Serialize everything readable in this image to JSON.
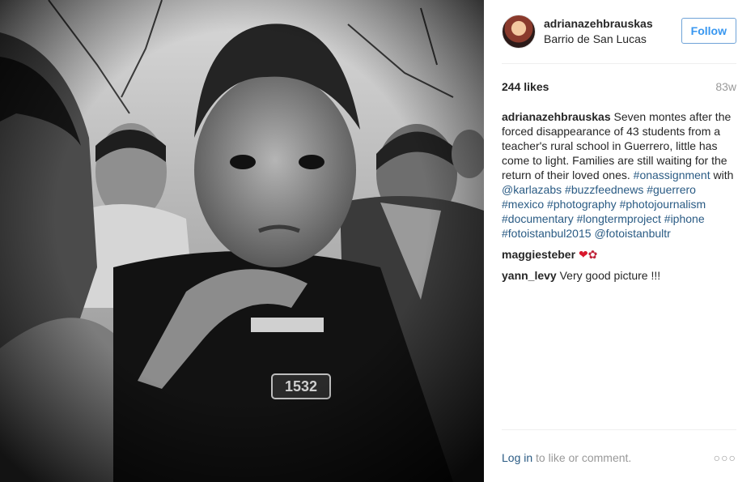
{
  "post": {
    "username": "adrianazehbrauskas",
    "location": "Barrio de San Lucas",
    "follow_label": "Follow",
    "likes": "244 likes",
    "age": "83w"
  },
  "caption": {
    "username": "adrianazehbrauskas",
    "text_1": " Seven montes after the forced disappearance of 43 students from a teacher's rural school in Guerrero, little has come to light. Families are still waiting for the return of their loved ones. ",
    "tag_1": "#onassignment",
    "with": " with ",
    "mention_1": "@karlazabs",
    "hashtags": [
      "#buzzfeednews",
      "#guerrero",
      "#mexico",
      "#photography",
      "#photojournalism",
      "#documentary",
      "#longtermproject",
      "#iphone",
      "#fotoistanbul2015"
    ],
    "mention_2": "@fotoistanbultr"
  },
  "comments": [
    {
      "username": "maggiesteber",
      "text": ""
    },
    {
      "username": "yann_levy",
      "text": " Very good picture !!!"
    }
  ],
  "comment_icons": [
    "heart-icon",
    "rose-icon"
  ],
  "footer": {
    "login": "Log in",
    "rest": " to like or comment.",
    "more": "○○○"
  },
  "colors": {
    "link": "#2a5b84",
    "follow": "#3897f0",
    "muted": "#999999"
  }
}
